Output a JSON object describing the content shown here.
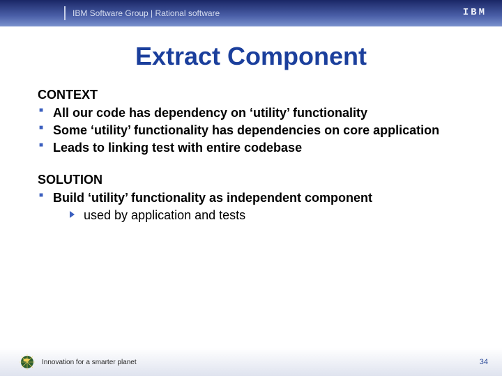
{
  "header": {
    "text": "IBM Software Group | Rational software",
    "logo": "IBM"
  },
  "title": "Extract Component",
  "context": {
    "heading": "CONTEXT",
    "items": [
      "All our code has dependency on ‘utility’ functionality",
      "Some ‘utility’ functionality has dependencies on core application",
      "Leads to linking test with entire codebase"
    ]
  },
  "solution": {
    "heading": "SOLUTION",
    "items": [
      "Build ‘utility’ functionality as independent component"
    ],
    "sub": [
      "used by application and tests"
    ]
  },
  "footer": {
    "tagline": "Innovation for a smarter planet",
    "page": "34"
  }
}
